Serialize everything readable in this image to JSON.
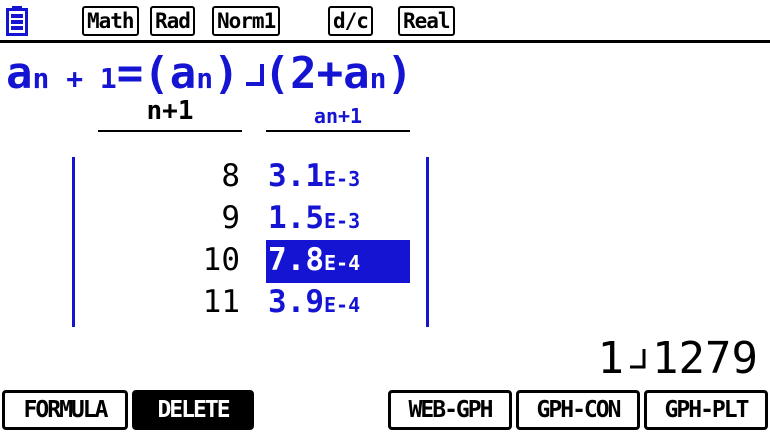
{
  "status": {
    "battery_icon": "battery-icon",
    "tags": [
      "Math",
      "Rad",
      "Norm1",
      "d/c",
      "Real"
    ]
  },
  "formula": {
    "p1": "a",
    "p2": "n + 1",
    "p3": "=(a",
    "p4": "n",
    "p5": ")",
    "p6": "(2+a",
    "p7": "n",
    "p8": ")"
  },
  "table": {
    "headers": [
      "n+1",
      "an+1"
    ],
    "rows": [
      {
        "n": "8",
        "mant": "3.1",
        "exp": "E-3",
        "selected": false
      },
      {
        "n": "9",
        "mant": "1.5",
        "exp": "E-3",
        "selected": false
      },
      {
        "n": "10",
        "mant": "7.8",
        "exp": "E-4",
        "selected": true
      },
      {
        "n": "11",
        "mant": "3.9",
        "exp": "E-4",
        "selected": false
      }
    ]
  },
  "result": {
    "whole": "1",
    "rest": "1279"
  },
  "fkeys": [
    "FORMULA",
    "DELETE",
    "WEB-GPH",
    "GPH-CON",
    "GPH-PLT"
  ],
  "colors": {
    "accent": "#1414d2"
  }
}
